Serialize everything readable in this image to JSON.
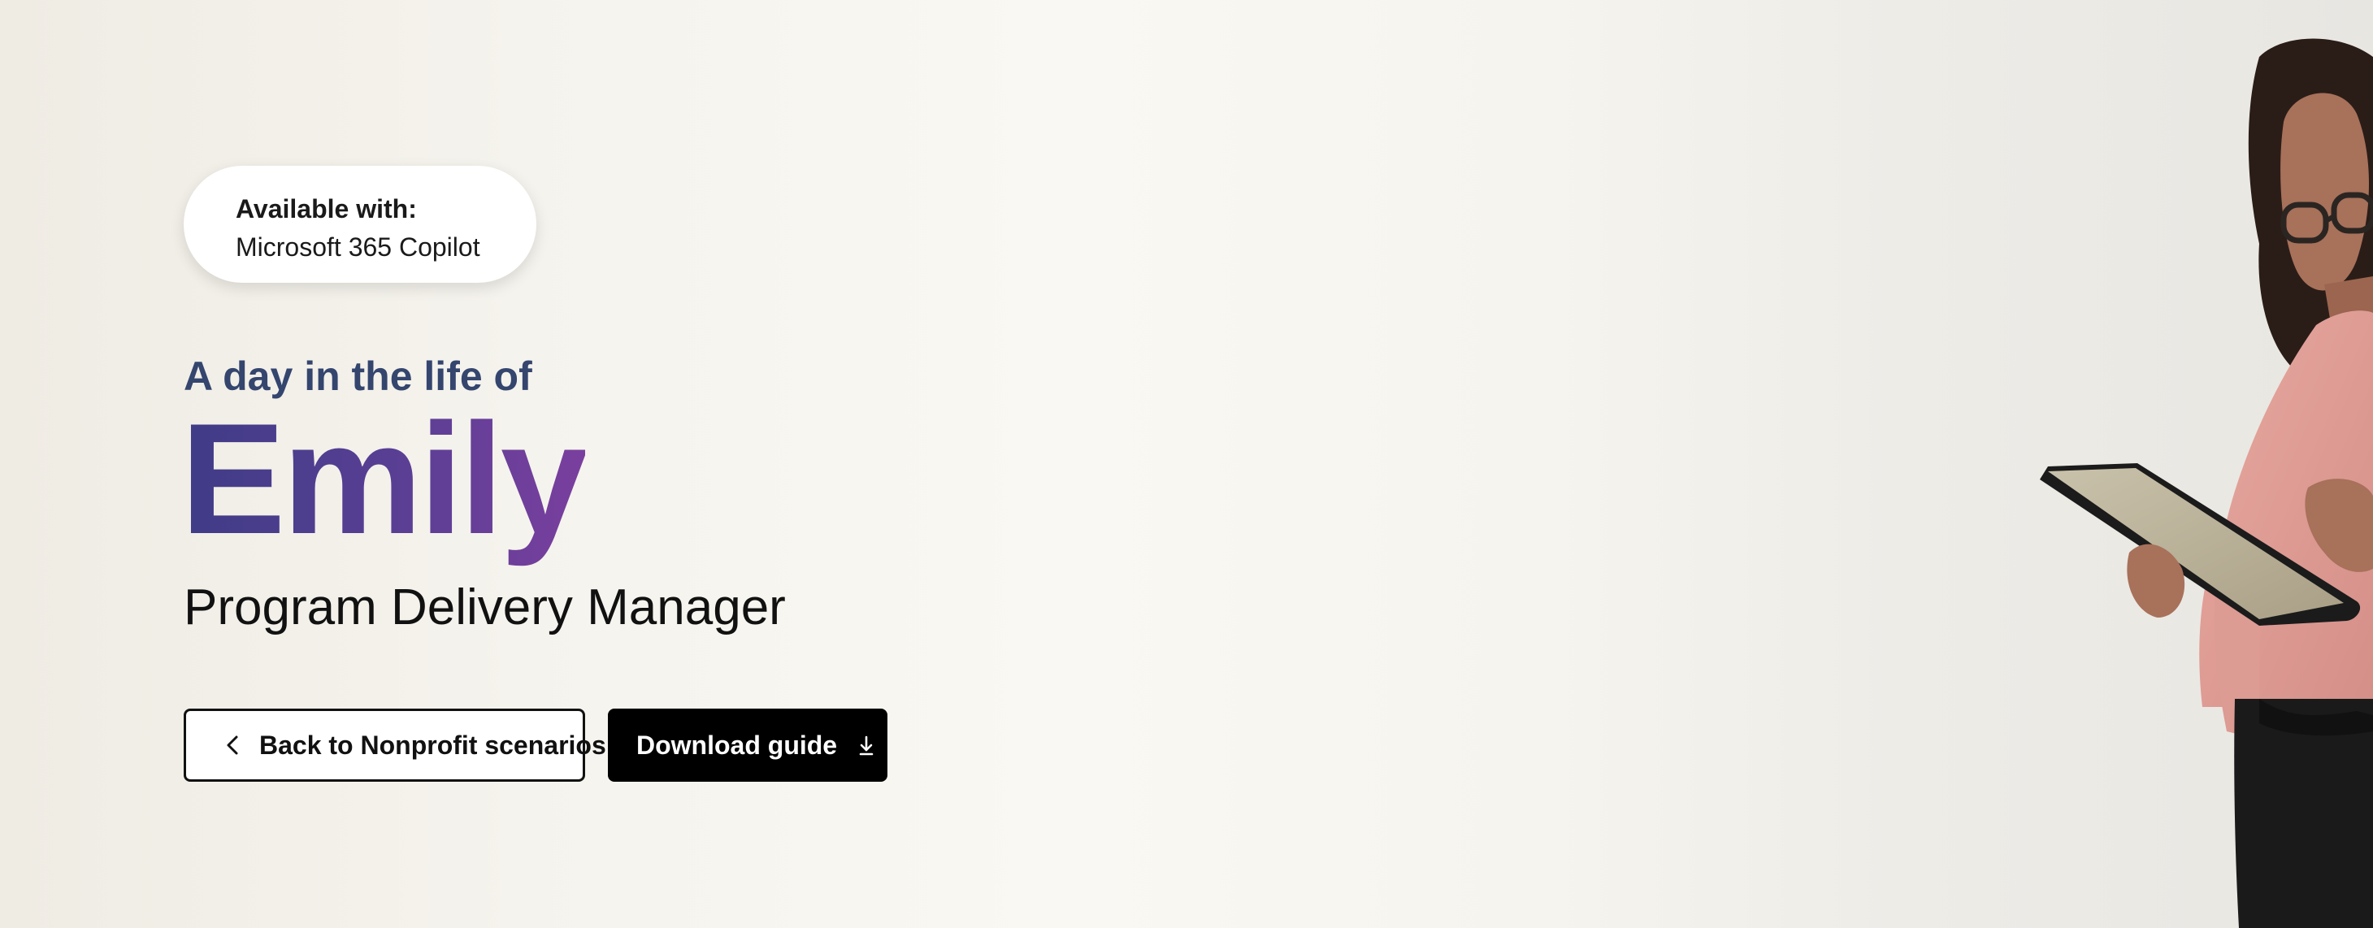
{
  "badge": {
    "label": "Available with:",
    "product": "Microsoft 365 Copilot"
  },
  "hero": {
    "eyebrow": "A day in the life of",
    "name": "Emily",
    "role": "Program Delivery Manager"
  },
  "actions": {
    "back_label": "Back to Nonprofit scenarios",
    "download_label": "Download guide"
  },
  "colors": {
    "eyebrow": "#34456e",
    "name_gradient_start": "#3f3c86",
    "name_gradient_end": "#7a3f9e",
    "button_dark": "#000000"
  },
  "icons": {
    "back": "chevron-left-icon",
    "download": "download-icon"
  }
}
